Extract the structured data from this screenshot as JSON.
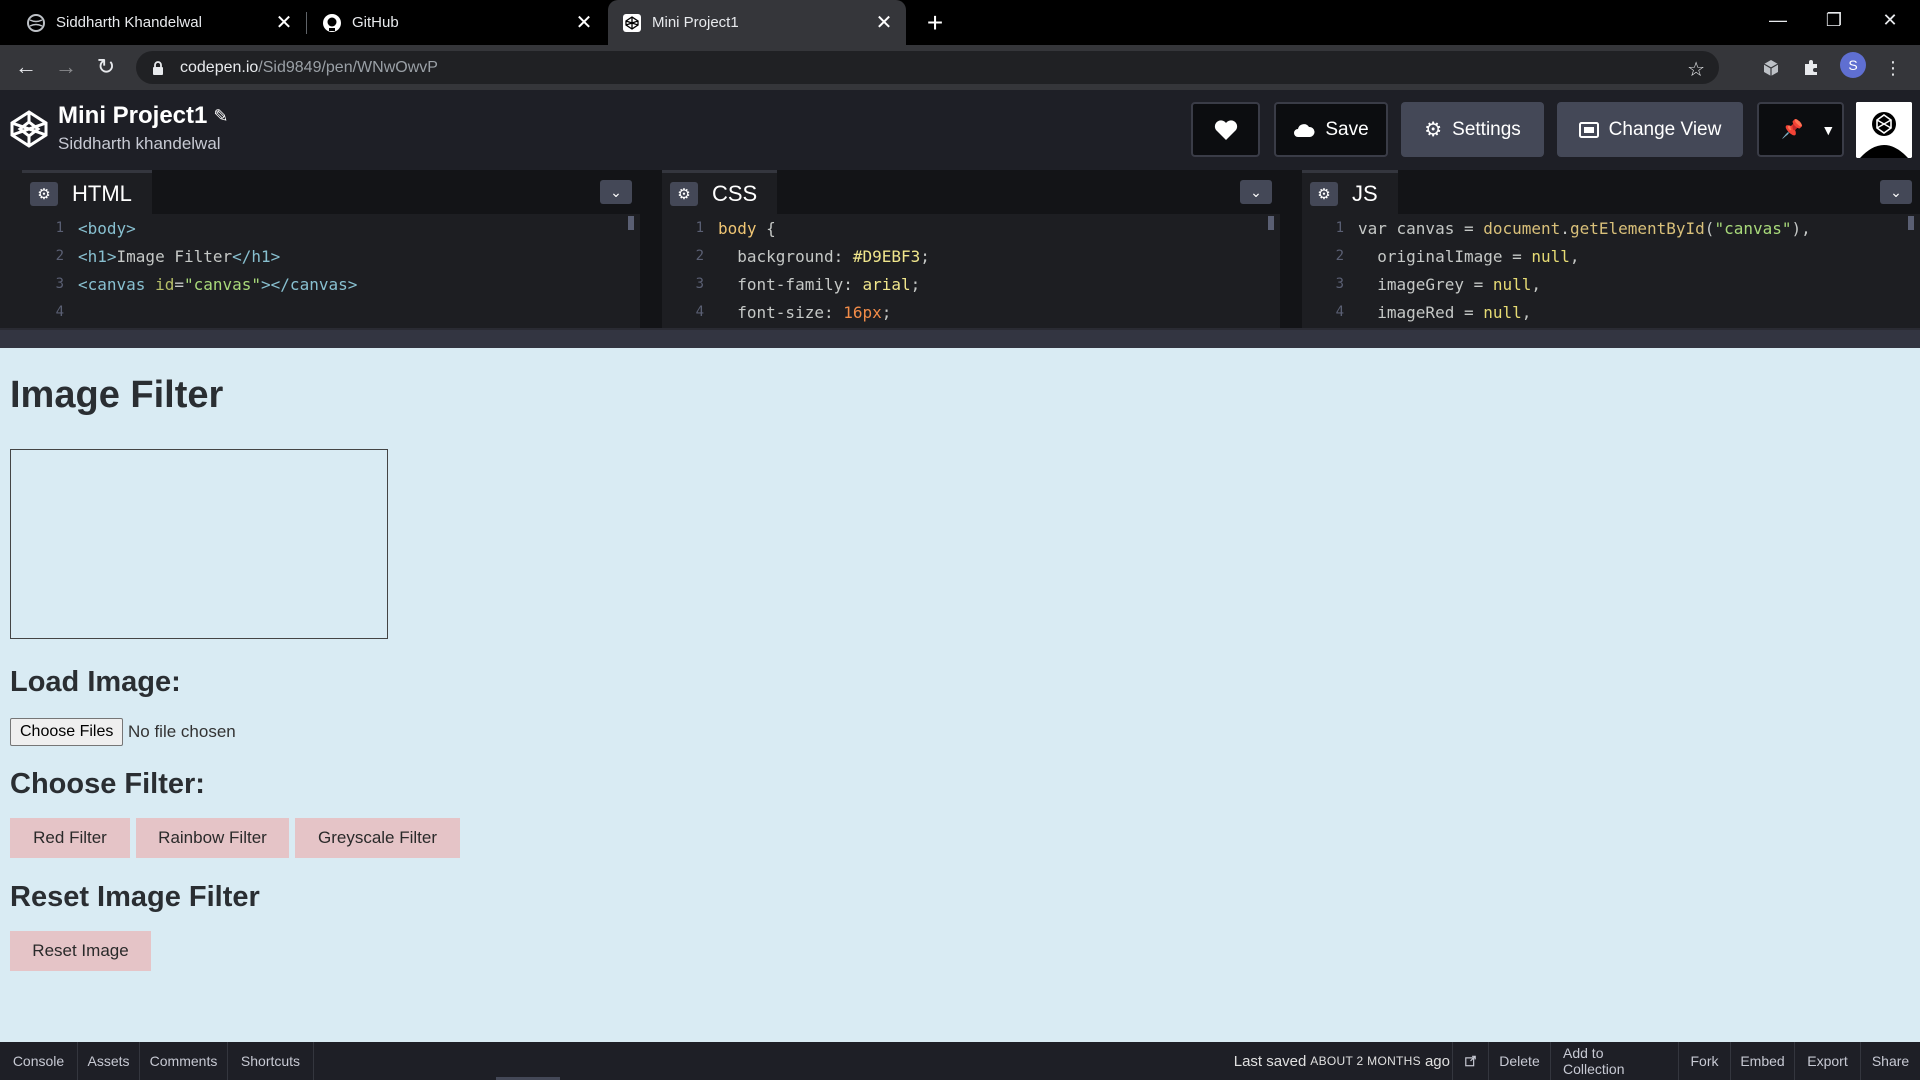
{
  "browser": {
    "tabs": [
      {
        "title": "Siddharth Khandelwal",
        "icon": "chrome-globe-icon",
        "active": false
      },
      {
        "title": "GitHub",
        "icon": "github-icon",
        "active": false
      },
      {
        "title": "Mini Project1",
        "icon": "codepen-icon",
        "active": true
      }
    ],
    "url_host": "codepen.io",
    "url_path": "/Sid9849/pen/WNwOwvP",
    "profile_initial": "S"
  },
  "codepen": {
    "title": "Mini Project1",
    "author": "Siddharth khandelwal",
    "buttons": {
      "save": "Save",
      "settings": "Settings",
      "change_view": "Change View"
    },
    "panes": {
      "html": {
        "label": "HTML",
        "lines": [
          {
            "n": "1",
            "text": "<body>"
          },
          {
            "n": "2",
            "text": "<h1>Image Filter</h1>"
          },
          {
            "n": "3",
            "text": "<canvas id=\"canvas\"></canvas>"
          },
          {
            "n": "4",
            "text": ""
          }
        ]
      },
      "css": {
        "label": "CSS",
        "lines": [
          {
            "n": "1",
            "text": "body {"
          },
          {
            "n": "2",
            "text": "  background: #D9EBF3;"
          },
          {
            "n": "3",
            "text": "  font-family: arial;"
          },
          {
            "n": "4",
            "text": "  font-size: 16px;"
          }
        ]
      },
      "js": {
        "label": "JS",
        "lines": [
          {
            "n": "1",
            "text": "var canvas = document.getElementById(\"canvas\"),"
          },
          {
            "n": "2",
            "text": "  originalImage = null,"
          },
          {
            "n": "3",
            "text": "  imageGrey = null,"
          },
          {
            "n": "4",
            "text": "  imageRed = null,"
          }
        ]
      }
    }
  },
  "preview": {
    "heading": "Image Filter",
    "load_heading": "Load Image:",
    "file_button": "Choose Files",
    "file_status": "No file chosen",
    "filter_heading": "Choose Filter:",
    "filters": [
      "Red Filter",
      "Rainbow Filter",
      "Greyscale Filter"
    ],
    "reset_heading": "Reset Image Filter",
    "reset_button": "Reset Image",
    "background": "#D9EBF3",
    "button_color": "#E5C4C7"
  },
  "footer": {
    "left": [
      "Console",
      "Assets",
      "Comments",
      "Shortcuts"
    ],
    "saved_prefix": "Last saved",
    "saved_when": "ABOUT 2 MONTHS",
    "saved_suffix": "ago",
    "right": [
      "Delete",
      "Add to Collection",
      "Fork",
      "Embed",
      "Export",
      "Share"
    ]
  }
}
